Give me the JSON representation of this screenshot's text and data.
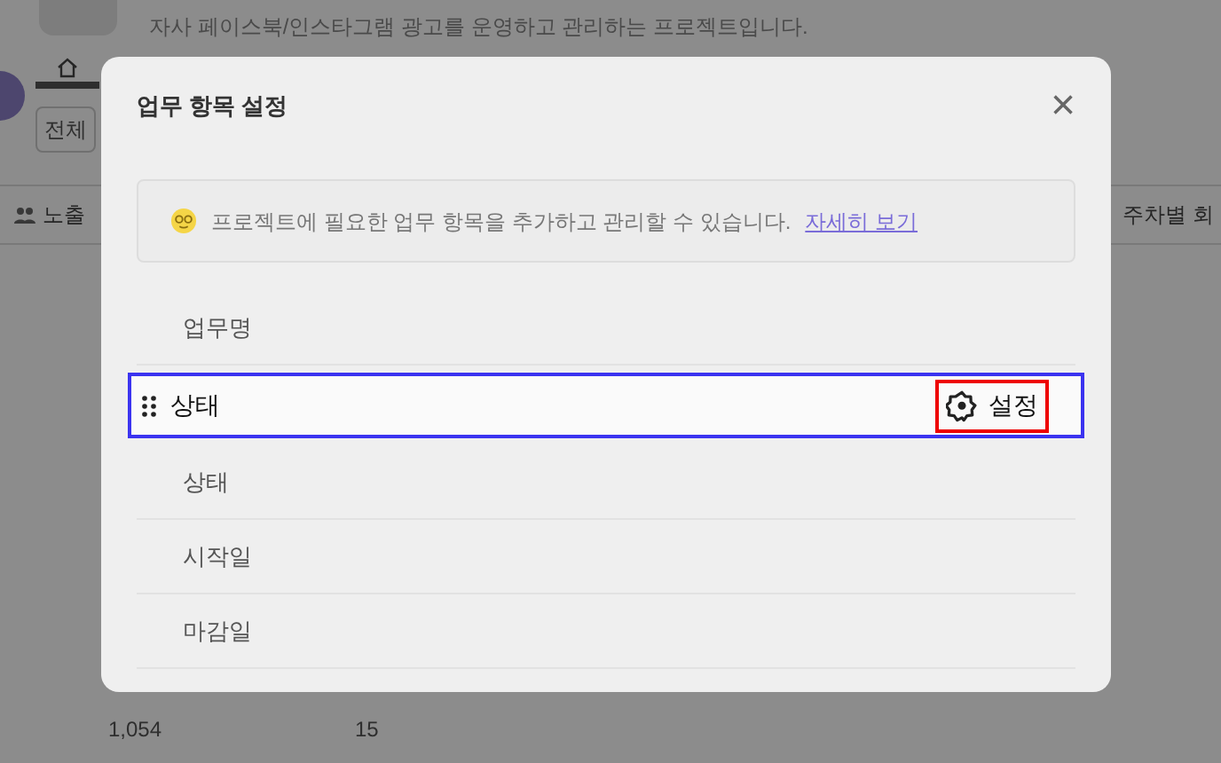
{
  "page": {
    "description": "자사 페이스북/인스타그램 광고를 운영하고 관리하는 프로젝트입니다.",
    "filter_button": "전체",
    "table": {
      "column_1": "노출",
      "column_right": "주차별 회",
      "row": [
        "1,054",
        "15"
      ]
    }
  },
  "dialog": {
    "title": "업무 항목 설정",
    "close": "×",
    "notice": {
      "text": "프로젝트에 필요한 업무 항목을 추가하고 관리할 수 있습니다.",
      "link": "자세히 보기"
    },
    "items": [
      {
        "kind": "item",
        "label": "업무명"
      },
      {
        "kind": "dragging",
        "label": "상태",
        "action": "설정"
      },
      {
        "kind": "item",
        "label": "상태"
      },
      {
        "kind": "item",
        "label": "시작일"
      },
      {
        "kind": "item",
        "label": "마감일"
      }
    ]
  }
}
